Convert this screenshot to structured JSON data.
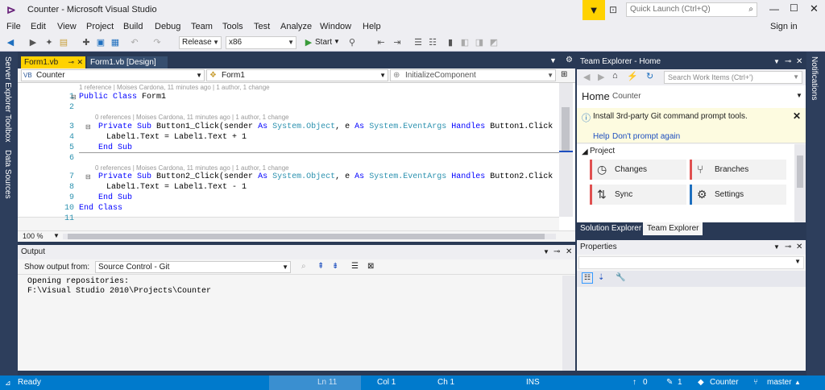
{
  "window": {
    "title": "Counter - Microsoft Visual Studio",
    "quick_launch": "Quick Launch (Ctrl+Q)",
    "sign_in": "Sign in"
  },
  "menu": [
    "File",
    "Edit",
    "View",
    "Project",
    "Build",
    "Debug",
    "Team",
    "Tools",
    "Test",
    "Analyze",
    "Window",
    "Help"
  ],
  "toolbar": {
    "config": "Release",
    "platform": "x86",
    "start": "Start"
  },
  "left_rail": [
    "Server Explorer",
    "Toolbox",
    "Data Sources"
  ],
  "right_rail": [
    "Notifications"
  ],
  "editor": {
    "tabs": [
      {
        "label": "Form1.vb"
      },
      {
        "label": "Form1.vb [Design]"
      }
    ],
    "nav": {
      "project": "Counter",
      "class": "Form1",
      "member": "InitializeComponent"
    },
    "zoom": "100 %",
    "line_numbers": [
      "1",
      "2",
      "3",
      "4",
      "5",
      "6",
      "7",
      "8",
      "9",
      "10",
      "11"
    ],
    "lens": {
      "class": "1 reference | Moises Cardona, 11 minutes ago | 1 author, 1 change",
      "sub1": "0 references | Moises Cardona, 11 minutes ago | 1 author, 1 change",
      "sub2": "0 references | Moises Cardona, 11 minutes ago | 1 author, 1 change"
    },
    "code": {
      "l1_kw": "Public Class",
      "l1_name": "Form1",
      "l3_kw": "Private Sub",
      "l3_rest": "Button1_Click(sender",
      "l3_as1": "As",
      "l3_sys1": "System.",
      "l3_obj": "Object",
      "l3_mid": ", e",
      "l3_as2": "As",
      "l3_sys2": "System.",
      "l3_args": "EventArgs",
      "l3_handles": "Handles",
      "l3_tail": "Button1.Click",
      "l4": "Label1.Text = Label1.Text + 1",
      "l5": "End Sub",
      "l7_kw": "Private Sub",
      "l7_rest": "Button2_Click(sender",
      "l7_as1": "As",
      "l7_sys1": "System.",
      "l7_obj": "Object",
      "l7_mid": ", e",
      "l7_as2": "As",
      "l7_sys2": "System.",
      "l7_args": "EventArgs",
      "l7_handles": "Handles",
      "l7_tail": "Button2.Click",
      "l8": "Label1.Text = Label1.Text - 1",
      "l9": "End Sub",
      "l10": "End Class"
    }
  },
  "output": {
    "title": "Output",
    "show_from_label": "Show output from:",
    "source": "Source Control - Git",
    "lines": [
      "Opening repositories:",
      "F:\\Visual Studio 2010\\Projects\\Counter"
    ]
  },
  "team_explorer": {
    "title": "Team Explorer - Home",
    "search_placeholder": "Search Work Items (Ctrl+')",
    "home": "Home",
    "context": "Counter",
    "info": "Install 3rd-party Git command prompt tools.",
    "help": "Help",
    "dont_prompt": "Don't prompt again",
    "section": "Project",
    "tiles": [
      "Changes",
      "Branches",
      "Sync",
      "Settings"
    ],
    "tabs": [
      "Solution Explorer",
      "Team Explorer"
    ]
  },
  "properties": {
    "title": "Properties"
  },
  "status": {
    "ready": "Ready",
    "ln": "Ln 11",
    "col": "Col 1",
    "ch": "Ch 1",
    "ins": "INS",
    "up": "0",
    "pencil": "1",
    "repo": "Counter",
    "branch": "master"
  },
  "colors": {
    "accent": "#007acc",
    "keyword": "#0000ff",
    "type": "#2b91af",
    "frame": "#293955"
  }
}
